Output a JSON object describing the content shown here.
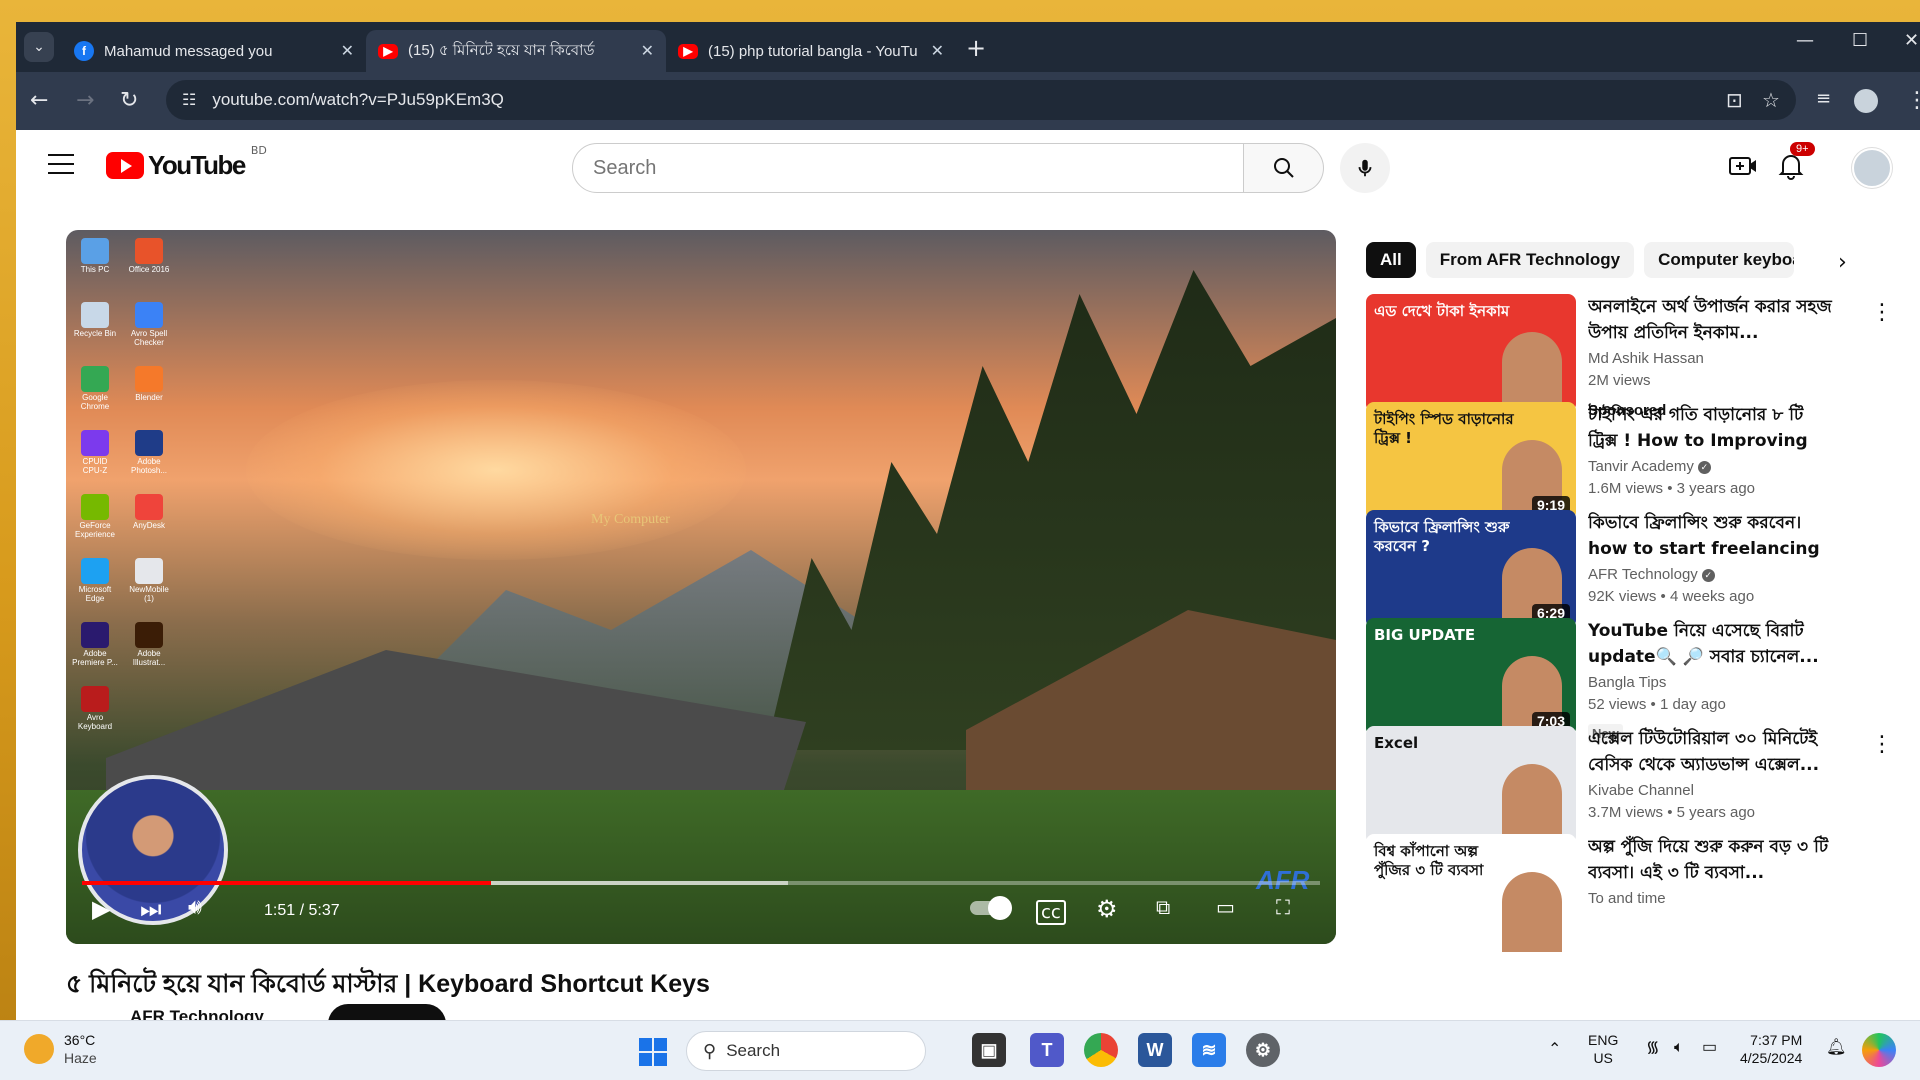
{
  "browser": {
    "tabs": [
      {
        "label": "Mahamud messaged you",
        "icon": "facebook-icon",
        "active": false
      },
      {
        "label": "(15) ৫ মিনিটে হয়ে যান কিবোর্ড",
        "icon": "youtube-icon",
        "active": true
      },
      {
        "label": "(15) php tutorial bangla - YouTu",
        "icon": "youtube-icon",
        "active": false
      }
    ],
    "url": "youtube.com/watch?v=PJu59pKEm3Q"
  },
  "youtube": {
    "logo_text": "YouTube",
    "country_code": "BD",
    "search_placeholder": "Search",
    "notification_count": "9+"
  },
  "player": {
    "current_time": "1:51",
    "total_time": "5:37",
    "time_display": "1:51 / 5:37",
    "progress_fraction": 0.33,
    "buffer_fraction": 0.57,
    "watermark": "My Computer",
    "brand_logo": "AFR",
    "desktop_icons": [
      {
        "label": "This PC",
        "color": "#5aa0e6"
      },
      {
        "label": "Office 2016",
        "color": "#e8532a"
      },
      {
        "label": "Recycle Bin",
        "color": "#c8d8e8"
      },
      {
        "label": "Avro Spell Checker",
        "color": "#3b82f6"
      },
      {
        "label": "Google Chrome",
        "color": "#34a853"
      },
      {
        "label": "Blender",
        "color": "#f5792a"
      },
      {
        "label": "CPUID CPU-Z",
        "color": "#7c3aed"
      },
      {
        "label": "Adobe Photosh...",
        "color": "#1f3c88"
      },
      {
        "label": "GeForce Experience",
        "color": "#76b900"
      },
      {
        "label": "AnyDesk",
        "color": "#ef443b"
      },
      {
        "label": "Microsoft Edge",
        "color": "#1da1f2"
      },
      {
        "label": "NewMobile (1)",
        "color": "#e5e7eb"
      },
      {
        "label": "Adobe Premiere P...",
        "color": "#2a1a6e"
      },
      {
        "label": "Adobe Illustrat...",
        "color": "#3b1d06"
      },
      {
        "label": "Avro Keyboard",
        "color": "#b91c1c"
      }
    ]
  },
  "video": {
    "title": "৫ মিনিটে হয়ে যান কিবোর্ড মাস্টার | Keyboard Shortcut Keys",
    "channel": "AFR Technology"
  },
  "chips": [
    "All",
    "From AFR Technology",
    "Computer keyboa"
  ],
  "recommendations": [
    {
      "title": "অনলাইনে অর্থ উপার্জন করার সহজ উপায় প্রতিদিন ইনকাম...",
      "channel": "Md Ashik Hassan",
      "views": "2M views",
      "age": "",
      "duration": "",
      "sponsored": "Sponsored",
      "badge": "",
      "thumb_text": "এড দেখে টাকা ইনকাম",
      "thumb_bg": "#e8372e",
      "verified": false,
      "menu": true
    },
    {
      "title": "টাইপিং এর গতি বাড়ানোর ৮ টি ট্রিক্স ! How to Improving Your...",
      "channel": "Tanvir Academy",
      "views": "1.6M views",
      "age": "3 years ago",
      "duration": "9:19",
      "sponsored": "",
      "badge": "",
      "thumb_text": "টাইপিং স্পিড বাড়ানোর ট্রিক্স !",
      "thumb_bg": "#f5c542",
      "verified": true,
      "menu": false
    },
    {
      "title": "কিভাবে ফ্রিলান্সিং শুরু করবেন। how to start freelancing for...",
      "channel": "AFR Technology",
      "views": "92K views",
      "age": "4 weeks ago",
      "duration": "6:29",
      "sponsored": "",
      "badge": "",
      "thumb_text": "কিভাবে ফ্রিলান্সিং শুরু করবেন ?",
      "thumb_bg": "#1e3a8a",
      "verified": true,
      "menu": false
    },
    {
      "title": "YouTube নিয়ে এসেছে বিরাট update🔍 🔎 সবার চ্যানেল...",
      "channel": "Bangla Tips",
      "views": "52 views",
      "age": "1 day ago",
      "duration": "7:03",
      "sponsored": "",
      "badge": "New",
      "thumb_text": "BIG UPDATE",
      "thumb_bg": "#166534",
      "verified": false,
      "menu": false
    },
    {
      "title": "এক্সেল টিউটোরিয়াল ৩০ মিনিটেই বেসিক থেকে অ্যাডভান্স এক্সেল...",
      "channel": "Kivabe Channel",
      "views": "3.7M views",
      "age": "5 years ago",
      "duration": "",
      "sponsored": "",
      "badge": "",
      "thumb_text": "Excel",
      "thumb_bg": "#e5e7eb",
      "verified": false,
      "menu": true
    },
    {
      "title": "অল্প পুঁজি দিয়ে শুরু করুন বড় ৩ টি ব্যবসা। এই ৩ টি ব্যবসা...",
      "channel": "To and time",
      "views": "",
      "age": "",
      "duration": "",
      "sponsored": "",
      "badge": "",
      "thumb_text": "বিশ্ব কাঁপানো অল্প পুঁজির ৩ টি ব্যবসা",
      "thumb_bg": "#ffffff",
      "verified": false,
      "menu": false
    }
  ],
  "taskbar": {
    "weather_temp": "36°C",
    "weather_desc": "Haze",
    "search_label": "Search",
    "lang_top": "ENG",
    "lang_bottom": "US",
    "time": "7:37 PM",
    "date": "4/25/2024"
  }
}
